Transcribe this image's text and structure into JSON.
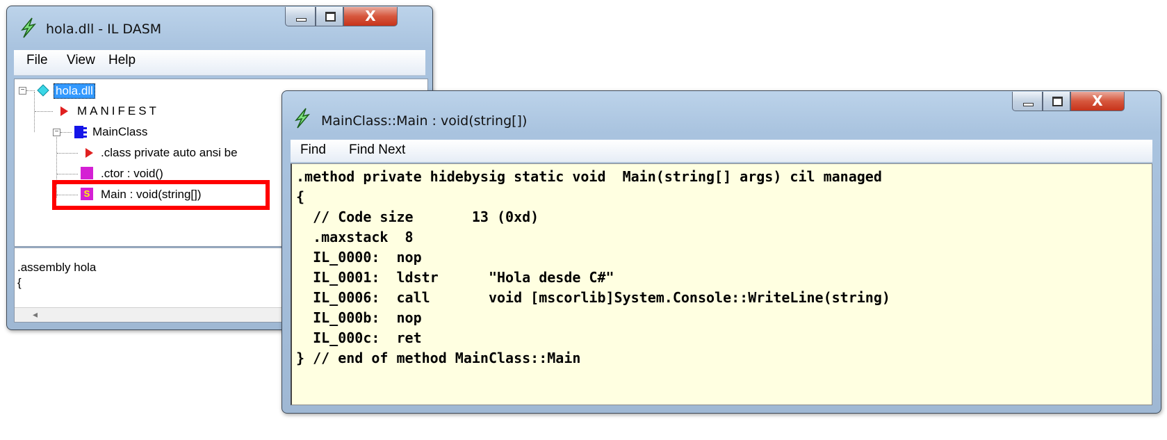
{
  "left_window": {
    "title": "hola.dll - IL DASM",
    "menu": [
      "File",
      "View",
      "Help"
    ],
    "tree": {
      "root": "hola.dll",
      "manifest": "MANIFEST",
      "class_name": "MainClass",
      "class_decl": ".class private auto ansi be",
      "ctor": ".ctor : void()",
      "main_badge": "S",
      "main": "Main : void(string[])"
    },
    "info_lines": [
      ".assembly hola",
      "{"
    ],
    "scroll_left_arrow": "◂"
  },
  "right_window": {
    "title": "MainClass::Main : void(string[])",
    "menu": [
      "Find",
      "Find Next"
    ],
    "code_lines": [
      ".method private hidebysig static void  Main(string[] args) cil managed",
      "{",
      "  // Code size       13 (0xd)",
      "  .maxstack  8",
      "  IL_0000:  nop",
      "  IL_0001:  ldstr      \"Hola desde C#\"",
      "  IL_0006:  call       void [mscorlib]System.Console::WriteLine(string)",
      "  IL_000b:  nop",
      "  IL_000c:  ret",
      "} // end of method MainClass::Main"
    ]
  },
  "window_controls": {
    "close_glyph": "X"
  },
  "colors": {
    "selection": "#3399ff",
    "highlight_box": "#ff0000",
    "code_background": "#ffffe1",
    "close_button": "#c7331a",
    "manifest_icon": "#e02020",
    "class_icon": "#1010e0",
    "method_icon": "#d020d0"
  },
  "icons": [
    "app-lightning-icon",
    "minimize-icon",
    "maximize-icon",
    "close-icon",
    "collapse-icon",
    "assembly-diamond-icon",
    "manifest-triangle-icon",
    "class-icon",
    "method-icon",
    "static-method-icon"
  ]
}
